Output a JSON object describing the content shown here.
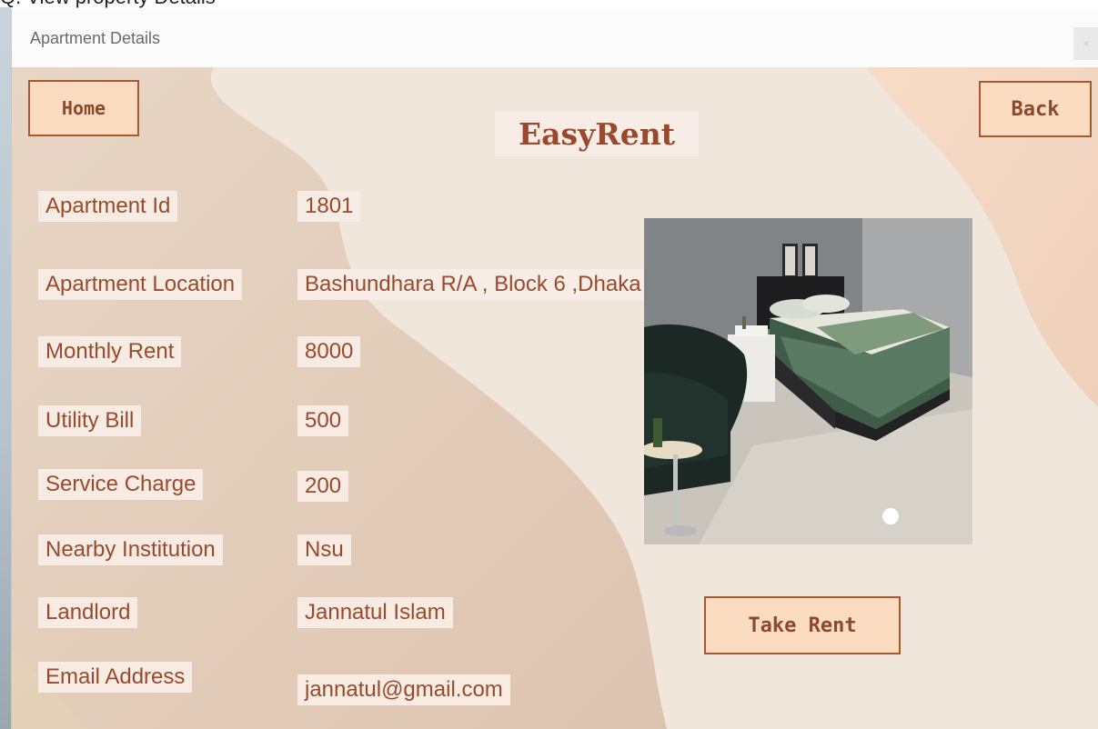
{
  "caption": "Q. View property Details",
  "window": {
    "title": "Apartment Details",
    "close_label": "×"
  },
  "brand": "EasyRent",
  "buttons": {
    "home": "Home",
    "back": "Back",
    "take_rent": "Take Rent"
  },
  "fields": [
    {
      "label": "Apartment Id",
      "value": "1801"
    },
    {
      "label": "Apartment Location",
      "value": "Bashundhara R/A , Block 6 ,Dhaka"
    },
    {
      "label": "Monthly Rent",
      "value": "8000"
    },
    {
      "label": "Utility Bill",
      "value": "500"
    },
    {
      "label": "Service Charge",
      "value": "200"
    },
    {
      "label": "Nearby Institution",
      "value": "Nsu"
    },
    {
      "label": "Landlord",
      "value": "Jannatul Islam"
    },
    {
      "label": "Email Address",
      "value": "jannatul@gmail.com"
    }
  ],
  "colors": {
    "text_accent": "#9a4a2c",
    "button_fill": "#fcdcc0",
    "button_border": "#a85a2e",
    "background": "#f1e6dc"
  }
}
